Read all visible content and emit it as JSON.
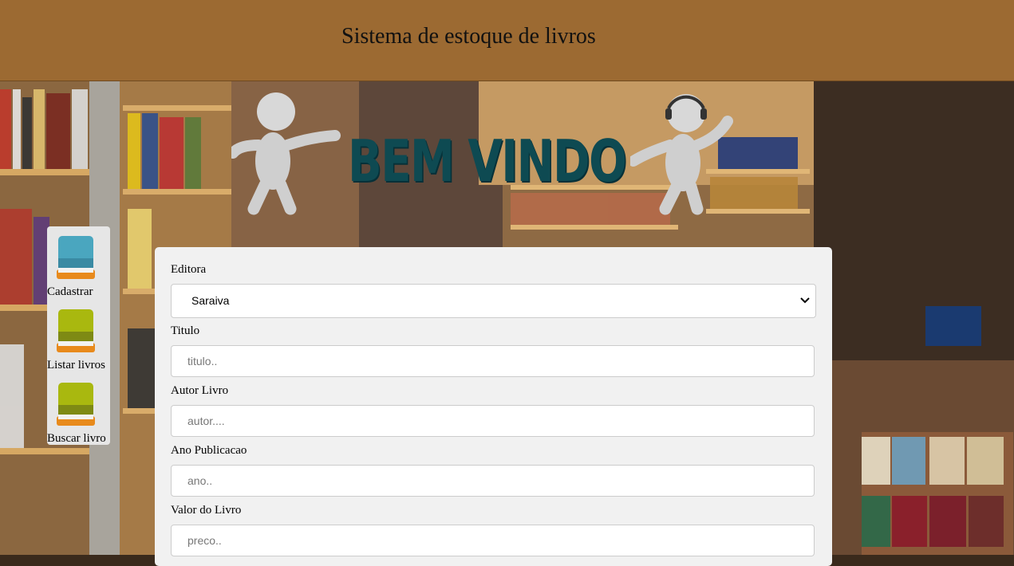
{
  "header": {
    "title": "Sistema de estoque de livros"
  },
  "banner": {
    "text": "BEM VINDO"
  },
  "menu": {
    "items": [
      {
        "label": "Cadastrar",
        "icon": "book-blue-icon",
        "color": "#4aa6bf"
      },
      {
        "label": "Listar livros",
        "icon": "book-green-icon",
        "color": "#a9b80f"
      },
      {
        "label": "Buscar livro",
        "icon": "book-green-icon",
        "color": "#a9b80f"
      }
    ]
  },
  "form": {
    "editora": {
      "label": "Editora",
      "value": "Saraiva"
    },
    "titulo": {
      "label": "Titulo",
      "placeholder": "titulo.."
    },
    "autor": {
      "label": "Autor Livro",
      "placeholder": "autor...."
    },
    "ano": {
      "label": "Ano Publicacao",
      "placeholder": "ano.."
    },
    "valor": {
      "label": "Valor do Livro",
      "placeholder": "preco.."
    }
  },
  "colors": {
    "header_bg": "#9c6a32",
    "banner_text": "#0e4a52",
    "panel_bg": "#f1f1f1"
  }
}
